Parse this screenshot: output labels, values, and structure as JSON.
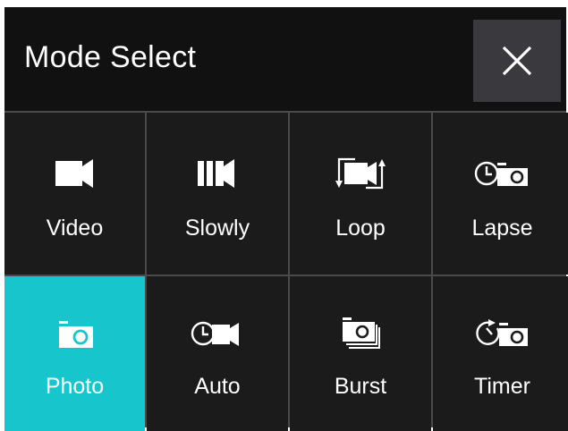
{
  "header": {
    "title": "Mode Select",
    "close_icon": "close-icon"
  },
  "modes": [
    {
      "label": "Video",
      "icon": "video-camera-icon",
      "selected": false
    },
    {
      "label": "Slowly",
      "icon": "slow-motion-icon",
      "selected": false
    },
    {
      "label": "Loop",
      "icon": "loop-recording-icon",
      "selected": false
    },
    {
      "label": "Lapse",
      "icon": "time-lapse-icon",
      "selected": false
    },
    {
      "label": "Photo",
      "icon": "photo-camera-icon",
      "selected": true
    },
    {
      "label": "Auto",
      "icon": "auto-capture-icon",
      "selected": false
    },
    {
      "label": "Burst",
      "icon": "burst-photo-icon",
      "selected": false
    },
    {
      "label": "Timer",
      "icon": "self-timer-icon",
      "selected": false
    }
  ],
  "colors": {
    "background": "#111111",
    "cell": "#1b1b1b",
    "selected": "#17c6cd",
    "close_button": "#3a3a3e",
    "grid_line": "#4a4a4a"
  }
}
